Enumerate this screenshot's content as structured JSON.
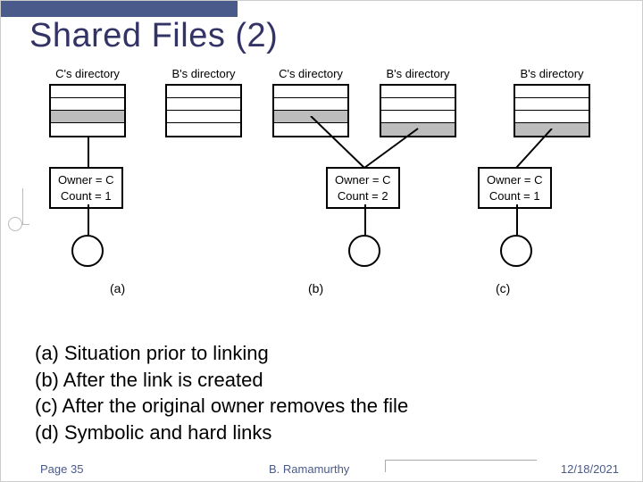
{
  "title": "Shared Files (2)",
  "diagram": {
    "groups": {
      "a": {
        "c_label": "C's directory",
        "b_label": "B's directory",
        "meta_line1": "Owner = C",
        "meta_line2": "Count = 1",
        "sub": "(a)"
      },
      "b": {
        "c_label": "C's directory",
        "b_label": "B's directory",
        "meta_line1": "Owner = C",
        "meta_line2": "Count = 2",
        "sub": "(b)"
      },
      "c": {
        "b_label": "B's directory",
        "meta_line1": "Owner = C",
        "meta_line2": "Count = 1",
        "sub": "(c)"
      }
    }
  },
  "bullets": {
    "a": "(a) Situation prior to linking",
    "b": "(b) After the link is created",
    "c": "(c) After the original owner removes the file",
    "d": "(d) Symbolic and hard links"
  },
  "footer": {
    "page": "Page 35",
    "author": "B. Ramamurthy",
    "date": "12/18/2021"
  }
}
